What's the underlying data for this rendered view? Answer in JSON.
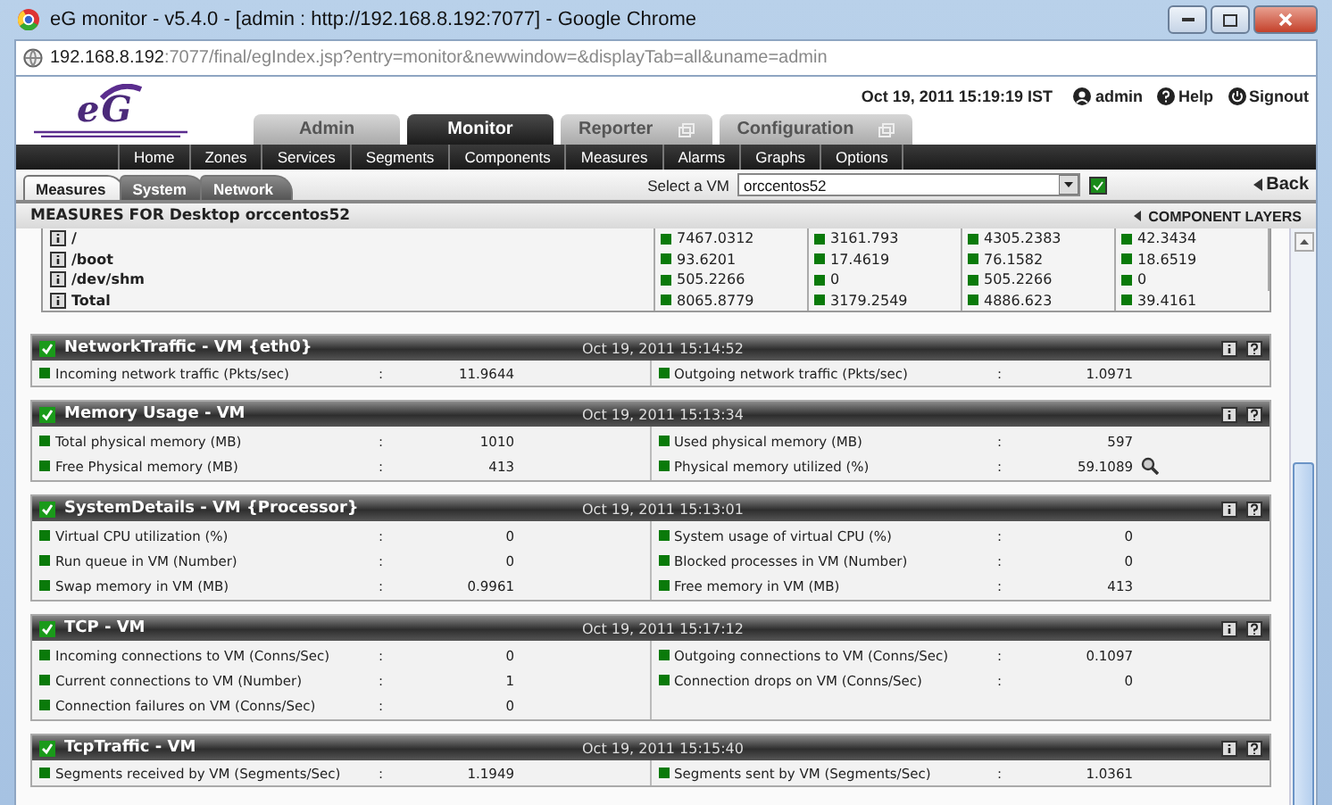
{
  "window": {
    "title": "eG monitor - v5.4.0 - [admin : http://192.168.8.192:7077] - Google Chrome"
  },
  "address": {
    "host": "192.168.8.192",
    "path": ":7077/final/egIndex.jsp?entry=monitor&newwindow=&displayTab=all&uname=admin"
  },
  "logo": {
    "text": "eG"
  },
  "header": {
    "datetime": "Oct 19, 2011 15:19:19 IST",
    "links": [
      {
        "kind": "user",
        "label": "admin"
      },
      {
        "kind": "help",
        "label": "Help"
      },
      {
        "kind": "signout",
        "label": "Signout"
      }
    ]
  },
  "main_tabs": [
    {
      "label": "Admin",
      "selected": false,
      "external": false
    },
    {
      "label": "Monitor",
      "selected": true,
      "external": false
    },
    {
      "label": "Reporter",
      "selected": false,
      "external": true
    },
    {
      "label": "Configuration",
      "selected": false,
      "external": true
    }
  ],
  "nav_items": [
    "Home",
    "Zones",
    "Services",
    "Segments",
    "Components",
    "Measures",
    "Alarms",
    "Graphs",
    "Options"
  ],
  "sub_tabs": [
    {
      "label": "Measures",
      "selected": true
    },
    {
      "label": "System",
      "selected": false
    },
    {
      "label": "Network",
      "selected": false
    }
  ],
  "vm_select": {
    "label": "Select a VM",
    "value": "orccentos52",
    "checked": true
  },
  "back": "Back",
  "page_title": "MEASURES FOR Desktop orccentos52",
  "component_layers": "COMPONENT LAYERS",
  "disk_table": [
    {
      "name": "/",
      "values": [
        "7467.0312",
        "3161.793",
        "4305.2383",
        "42.3434"
      ]
    },
    {
      "name": "/boot",
      "values": [
        "93.6201",
        "17.4619",
        "76.1582",
        "18.6519"
      ]
    },
    {
      "name": "/dev/shm",
      "values": [
        "505.2266",
        "0",
        "505.2266",
        "0"
      ]
    },
    {
      "name": "Total",
      "values": [
        "8065.8779",
        "3179.2549",
        "4886.623",
        "39.4161"
      ]
    }
  ],
  "sections": [
    {
      "title": "NetworkTraffic - VM {eth0}",
      "timestamp": "Oct 19, 2011 15:14:52",
      "left": [
        {
          "label": "Incoming network traffic (Pkts/sec)",
          "colon": ":",
          "value": "11.9644"
        }
      ],
      "right": [
        {
          "label": "Outgoing network traffic (Pkts/sec)",
          "colon": ":",
          "value": "1.0971"
        }
      ]
    },
    {
      "title": "Memory Usage - VM",
      "timestamp": "Oct 19, 2011 15:13:34",
      "left": [
        {
          "label": "Total physical memory (MB)",
          "colon": ":",
          "value": "1010"
        },
        {
          "label": "Free Physical memory (MB)",
          "colon": ":",
          "value": "413"
        }
      ],
      "right": [
        {
          "label": "Used physical memory (MB)",
          "colon": ":",
          "value": "597"
        },
        {
          "label": "Physical memory utilized (%)",
          "colon": ":",
          "value": "59.1089",
          "has_graph": true
        }
      ]
    },
    {
      "title": "SystemDetails - VM {Processor}",
      "timestamp": "Oct 19, 2011 15:13:01",
      "left": [
        {
          "label": "Virtual CPU utilization (%)",
          "colon": ":",
          "value": "0"
        },
        {
          "label": "Run queue in VM (Number)",
          "colon": ":",
          "value": "0"
        },
        {
          "label": "Swap memory in VM (MB)",
          "colon": ":",
          "value": "0.9961"
        }
      ],
      "right": [
        {
          "label": "System usage of virtual CPU (%)",
          "colon": ":",
          "value": "0"
        },
        {
          "label": "Blocked processes in VM (Number)",
          "colon": ":",
          "value": "0"
        },
        {
          "label": "Free memory in VM (MB)",
          "colon": ":",
          "value": "413"
        }
      ]
    },
    {
      "title": "TCP - VM",
      "timestamp": "Oct 19, 2011 15:17:12",
      "left": [
        {
          "label": "Incoming connections to VM (Conns/Sec)",
          "colon": ":",
          "value": "0"
        },
        {
          "label": "Current connections to VM (Number)",
          "colon": ":",
          "value": "1"
        },
        {
          "label": "Connection failures on VM (Conns/Sec)",
          "colon": ":",
          "value": "0"
        }
      ],
      "right": [
        {
          "label": "Outgoing connections to VM (Conns/Sec)",
          "colon": ":",
          "value": "0.1097"
        },
        {
          "label": "Connection drops on VM (Conns/Sec)",
          "colon": ":",
          "value": "0"
        }
      ]
    },
    {
      "title": "TcpTraffic - VM",
      "timestamp": "Oct 19, 2011 15:15:40",
      "left": [
        {
          "label": "Segments received by VM (Segments/Sec)",
          "colon": ":",
          "value": "1.1949"
        }
      ],
      "right": [
        {
          "label": "Segments sent by VM (Segments/Sec)",
          "colon": ":",
          "value": "1.0361"
        }
      ]
    }
  ]
}
